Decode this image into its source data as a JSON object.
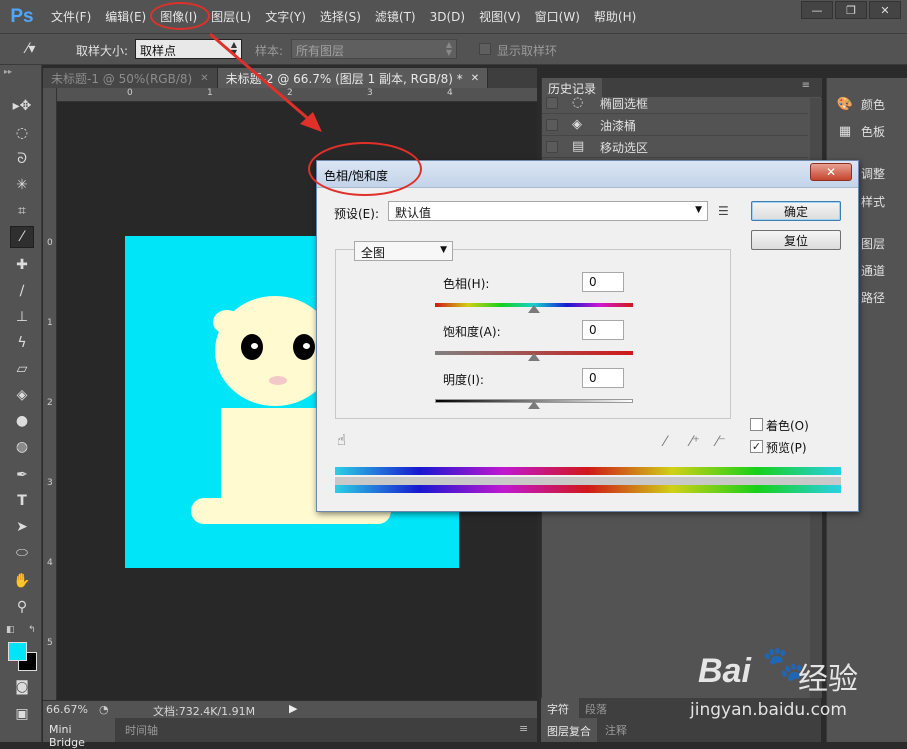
{
  "app": {
    "logo": "Ps"
  },
  "menu": [
    "文件(F)",
    "编辑(E)",
    "图像(I)",
    "图层(L)",
    "文字(Y)",
    "选择(S)",
    "滤镜(T)",
    "3D(D)",
    "视图(V)",
    "窗口(W)",
    "帮助(H)"
  ],
  "window_controls": {
    "minimize": "—",
    "restore": "❐",
    "close": "✕"
  },
  "options_bar": {
    "sample_size_label": "取样大小:",
    "sample_size_value": "取样点",
    "sample_label": "样本:",
    "sample_value": "所有图层",
    "show_ring_label": "显示取样环"
  },
  "tabs": [
    {
      "label": "未标题-1 @ 50%(RGB/8)",
      "close": "✕"
    },
    {
      "label": "未标题-2 @ 66.7% (图层 1 副本, RGB/8) *",
      "close": "✕"
    }
  ],
  "ruler": {
    "h": [
      "0",
      "1",
      "2",
      "3",
      "4"
    ],
    "v": [
      "0",
      "1",
      "2",
      "3",
      "4",
      "5"
    ]
  },
  "status": {
    "zoom": "66.67%",
    "doc_info": "文档:732.4K/1.91M"
  },
  "bottom_tabs": [
    "Mini Bridge",
    "时间轴"
  ],
  "history": {
    "title": "历史记录",
    "items": [
      {
        "icon": "◌",
        "label": "椭圆选框"
      },
      {
        "icon": "◈",
        "label": "油漆桶"
      },
      {
        "icon": "▤",
        "label": "移动选区"
      }
    ]
  },
  "dock": [
    "颜色",
    "色板",
    "调整",
    "样式",
    "图层",
    "通道",
    "路径"
  ],
  "char_tabs": [
    "字符",
    "段落"
  ],
  "layer_comp_tabs": [
    "图层复合",
    "注释"
  ],
  "dialog": {
    "title": "色相/饱和度",
    "close": "✕",
    "preset_label": "预设(E):",
    "preset_value": "默认值",
    "ok": "确定",
    "reset": "复位",
    "channel": "全图",
    "hue_label": "色相(H):",
    "hue_value": "0",
    "saturation_label": "饱和度(A):",
    "saturation_value": "0",
    "lightness_label": "明度(I):",
    "lightness_value": "0",
    "colorize_label": "着色(O)",
    "preview_label": "预览(P)",
    "preview_checked": "✓"
  },
  "watermark": {
    "brand": "Bai",
    "brand2": "经验",
    "url": "jingyan.baidu.com"
  },
  "colors": {
    "foreground": "#00e6f8",
    "background": "#000000",
    "canvas": "#00e6f8",
    "annotation": "#e0302a"
  }
}
